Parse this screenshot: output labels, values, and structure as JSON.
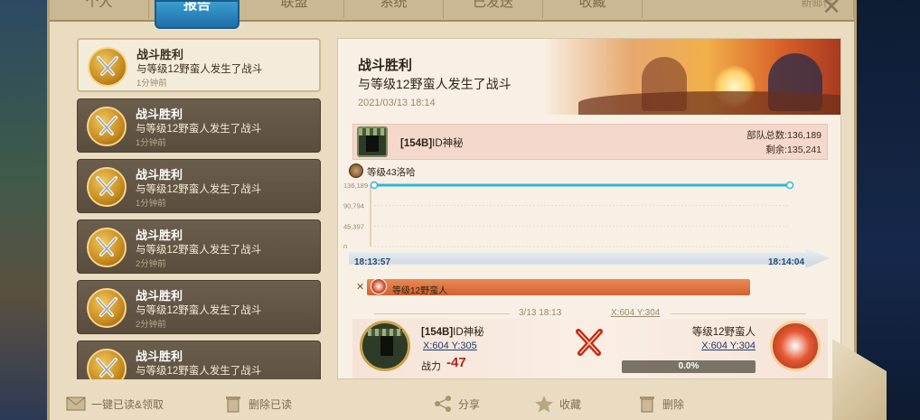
{
  "tabs": [
    {
      "label": "个人",
      "active": false
    },
    {
      "label": "报告",
      "active": true
    },
    {
      "label": "联盟",
      "active": false
    },
    {
      "label": "系统",
      "active": false
    },
    {
      "label": "已发送",
      "active": false
    },
    {
      "label": "收藏",
      "active": false
    }
  ],
  "tab_extra": "新邮件",
  "reports": [
    {
      "title": "战斗胜利",
      "desc": "与等级12野蛮人发生了战斗",
      "time": "1分钟前",
      "selected": true
    },
    {
      "title": "战斗胜利",
      "desc": "与等级12野蛮人发生了战斗",
      "time": "1分钟前",
      "selected": false
    },
    {
      "title": "战斗胜利",
      "desc": "与等级12野蛮人发生了战斗",
      "time": "1分钟前",
      "selected": false
    },
    {
      "title": "战斗胜利",
      "desc": "与等级12野蛮人发生了战斗",
      "time": "2分钟前",
      "selected": false
    },
    {
      "title": "战斗胜利",
      "desc": "与等级12野蛮人发生了战斗",
      "time": "2分钟前",
      "selected": false
    },
    {
      "title": "战斗胜利",
      "desc": "与等级12野蛮人发生了战斗",
      "time": "",
      "selected": false
    }
  ],
  "detail": {
    "title": "战斗胜利",
    "subtitle": "与等级12野蛮人发生了战斗",
    "date": "2021/03/13 18:14",
    "player_tag": "[154B]",
    "player_name": "ID神秘",
    "total_troops": "部队总数:136,189",
    "remaining": "剩余:135,241",
    "hero_label": "等级43洛哈",
    "time_start": "18:13:57",
    "time_end": "18:14:04",
    "enemy_label": "等级12野蛮人",
    "battle_date": "3/13 18:13",
    "battle_coord": "X:604 Y:304",
    "left_tag": "[154B]",
    "left_name": "ID神秘",
    "left_coord": "X:604 Y:305",
    "power_label": "战力",
    "power_value": "-47",
    "right_name": "等级12野蛮人",
    "right_coord": "X:604 Y:304",
    "right_percent": "0.0%"
  },
  "chart_data": {
    "type": "line",
    "x": [
      "18:13:57",
      "18:14:04"
    ],
    "series": [
      {
        "values": [
          136189,
          136189
        ]
      }
    ],
    "yticks": [
      "136,189",
      "90,794",
      "45,397",
      "0"
    ],
    "ylim": [
      0,
      136189
    ]
  },
  "toolbar": {
    "read_all": "一键已读&领取",
    "delete_read": "删除已读",
    "share": "分享",
    "favorite": "收藏",
    "delete": "删除"
  },
  "colors": {
    "accent_blue": "#2a86c2",
    "line_cyan": "#2fb7d6",
    "enemy_orange": "#d86632",
    "power_red": "#b5241a"
  }
}
